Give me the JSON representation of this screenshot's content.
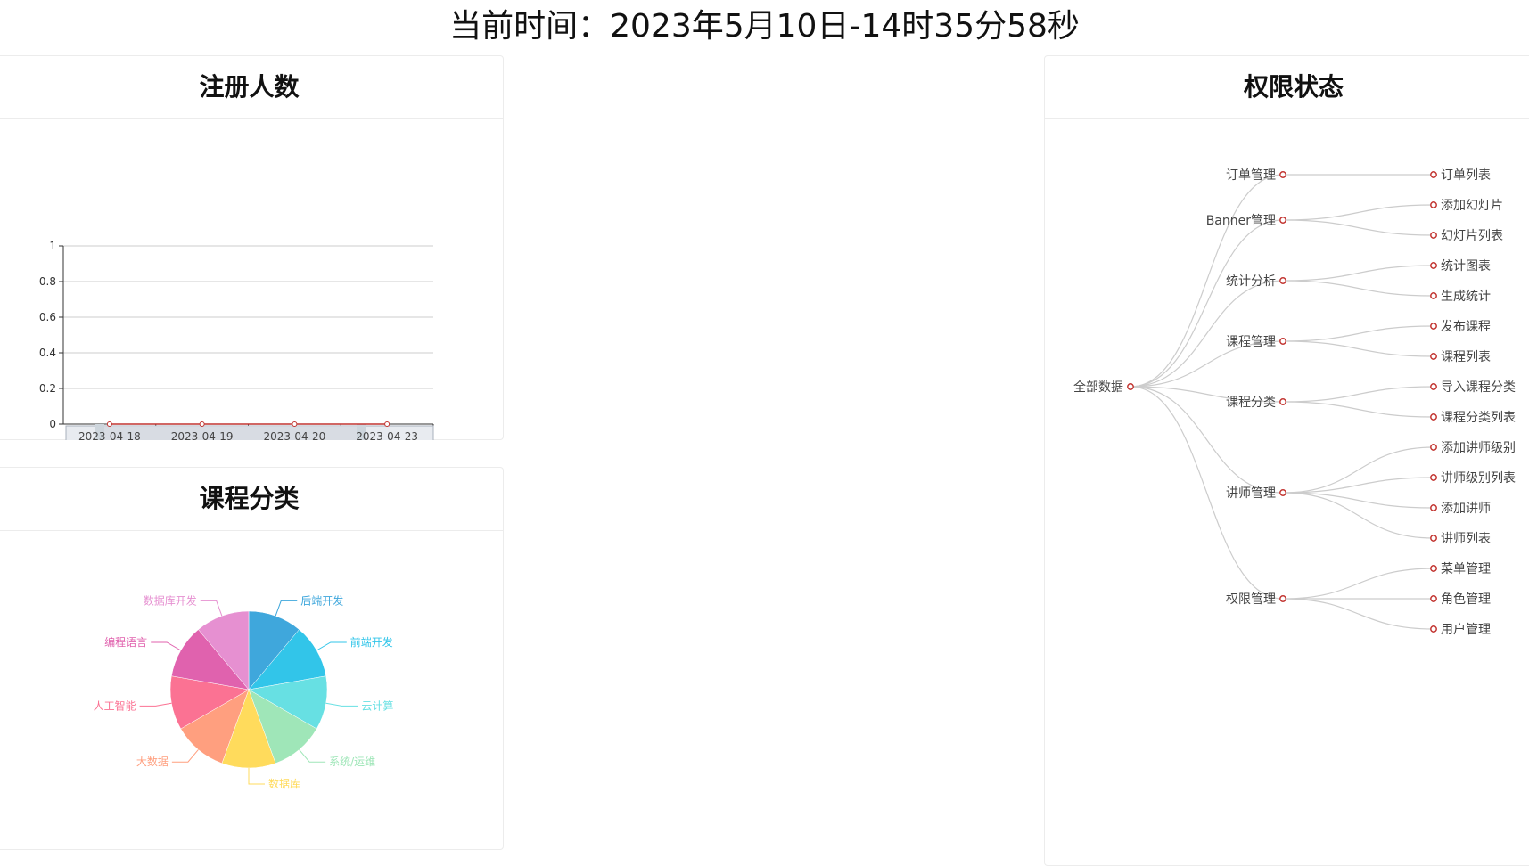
{
  "header": {
    "time_text": "当前时间：2023年5月10日-14时35分58秒"
  },
  "register_card": {
    "title": "注册人数"
  },
  "category_card": {
    "title": "课程分类"
  },
  "permission_card": {
    "title": "权限状态"
  },
  "colors": {
    "line": "#c23531",
    "grid": "#cccccc",
    "tree_link": "#cccccc",
    "tree_node": "#c23531"
  },
  "chart_data": [
    {
      "type": "line",
      "title": "注册人数",
      "categories": [
        "2023-04-18",
        "2023-04-19",
        "2023-04-20",
        "2023-04-23"
      ],
      "series": [
        {
          "values": [
            0,
            0,
            0,
            0
          ]
        }
      ],
      "ylim": [
        0,
        1
      ],
      "yticks": [
        "0",
        "0.2",
        "0.4",
        "0.6",
        "0.8",
        "1"
      ],
      "grid": true,
      "data_zoom": true
    },
    {
      "type": "pie",
      "title": "课程分类",
      "slices": [
        {
          "label": "后端开发",
          "value": 1,
          "color": "#3fa7dc"
        },
        {
          "label": "前端开发",
          "value": 1,
          "color": "#32c5e9"
        },
        {
          "label": "云计算",
          "value": 1,
          "color": "#67e0e3"
        },
        {
          "label": "系统/运维",
          "value": 1,
          "color": "#9fe6b8"
        },
        {
          "label": "数据库",
          "value": 1,
          "color": "#ffdb5c"
        },
        {
          "label": "大数据",
          "value": 1,
          "color": "#ff9f7f"
        },
        {
          "label": "人工智能",
          "value": 1,
          "color": "#fb7293"
        },
        {
          "label": "编程语言",
          "value": 1,
          "color": "#e062ae"
        },
        {
          "label": "数据库开发",
          "value": 1,
          "color": "#e690d1"
        }
      ]
    }
  ],
  "permission_tree": {
    "root": "全部数据",
    "children": [
      {
        "label": "订单管理",
        "children": [
          "订单列表"
        ]
      },
      {
        "label": "Banner管理",
        "children": [
          "添加幻灯片",
          "幻灯片列表"
        ]
      },
      {
        "label": "统计分析",
        "children": [
          "统计图表",
          "生成统计"
        ]
      },
      {
        "label": "课程管理",
        "children": [
          "发布课程",
          "课程列表"
        ]
      },
      {
        "label": "课程分类",
        "children": [
          "导入课程分类",
          "课程分类列表"
        ]
      },
      {
        "label": "讲师管理",
        "children": [
          "添加讲师级别",
          "讲师级别列表",
          "添加讲师",
          "讲师列表"
        ]
      },
      {
        "label": "权限管理",
        "children": [
          "菜单管理",
          "角色管理",
          "用户管理"
        ]
      }
    ]
  }
}
